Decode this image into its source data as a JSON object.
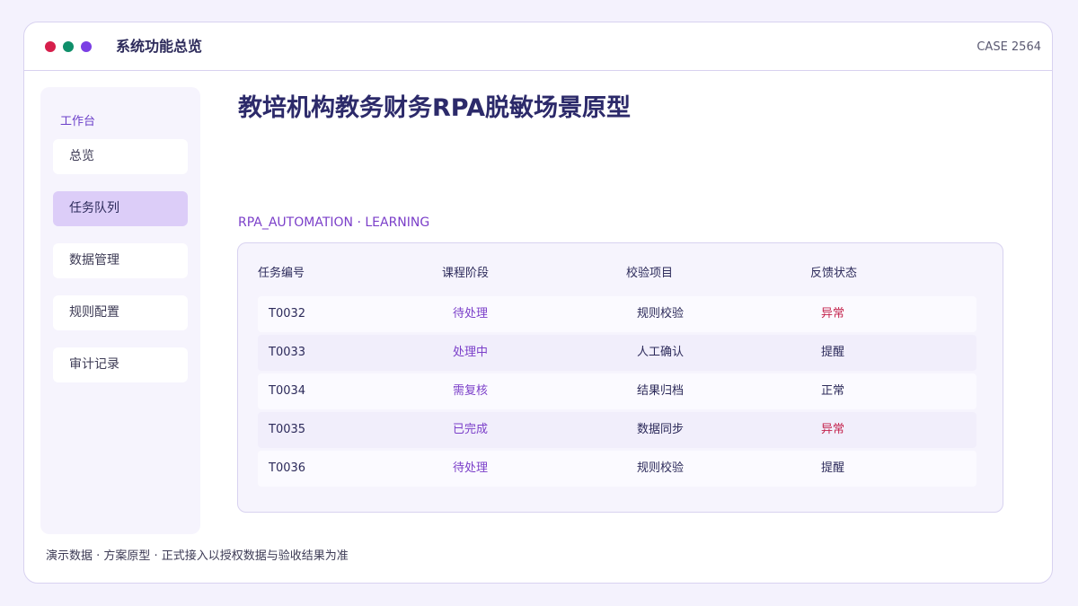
{
  "window": {
    "title": "系统功能总览",
    "case_label": "CASE 2564"
  },
  "sidebar": {
    "heading": "工作台",
    "items": [
      {
        "label": "总览"
      },
      {
        "label": "任务队列"
      },
      {
        "label": "数据管理"
      },
      {
        "label": "规则配置"
      },
      {
        "label": "审计记录"
      }
    ],
    "active_index": 1
  },
  "main": {
    "title": "教培机构教务财务RPA脱敏场景原型",
    "section_label": "RPA_AUTOMATION · LEARNING",
    "table": {
      "columns": [
        "任务编号",
        "课程阶段",
        "校验项目",
        "反馈状态"
      ],
      "rows": [
        {
          "id": "T0032",
          "stage": "待处理",
          "check": "规则校验",
          "status": "异常"
        },
        {
          "id": "T0033",
          "stage": "处理中",
          "check": "人工确认",
          "status": "提醒"
        },
        {
          "id": "T0034",
          "stage": "需复核",
          "check": "结果归档",
          "status": "正常"
        },
        {
          "id": "T0035",
          "stage": "已完成",
          "check": "数据同步",
          "status": "异常"
        },
        {
          "id": "T0036",
          "stage": "待处理",
          "check": "规则校验",
          "status": "提醒"
        }
      ]
    }
  },
  "footer": {
    "note": "演示数据 · 方案原型 · 正式接入以授权数据与验收结果为准"
  },
  "colors": {
    "accent": "#7b3fc9",
    "active_nav": "#dccdf8",
    "status_abnormal": "#c4244e",
    "dot_red": "#d61f4b",
    "dot_green": "#0f8f6a",
    "dot_purple": "#7b3fe4"
  }
}
